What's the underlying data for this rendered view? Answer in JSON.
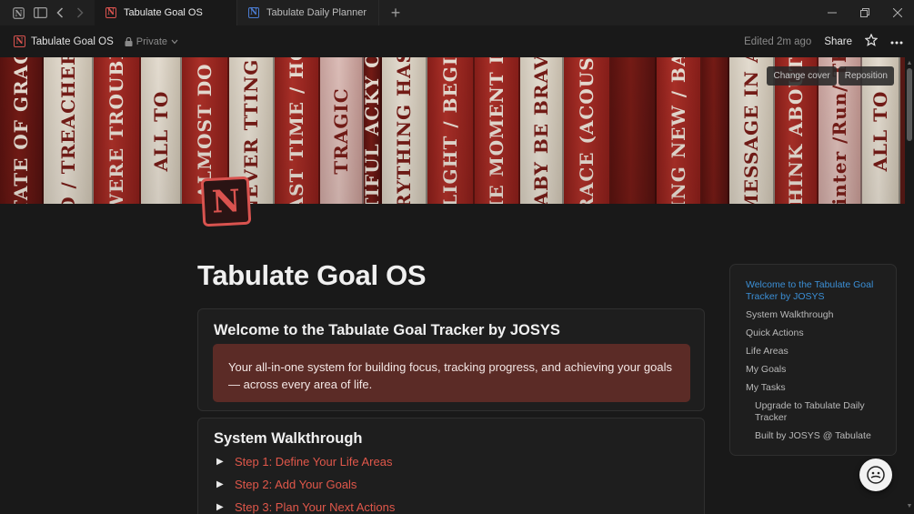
{
  "tabs": [
    {
      "label": "Tabulate Goal OS",
      "active": true,
      "icon": "notion-red-icon"
    },
    {
      "label": "Tabulate Daily Planner",
      "active": false,
      "icon": "notion-blue-icon"
    }
  ],
  "window_controls": {
    "new_tab": "+",
    "minimize": "–",
    "restore": "❐",
    "close": "✕"
  },
  "header": {
    "title": "Tabulate Goal OS",
    "privacy": "Private",
    "edited": "Edited 2m ago",
    "share": "Share"
  },
  "cover": {
    "change_cover": "Change cover",
    "reposition": "Reposition",
    "spines": [
      "STATE OF GRACE",
      "D / TREACHER",
      "I WERE TROUBLE",
      "ALL TO",
      "ALMOST DO",
      "WE ARE NEVER TTING BACK TO",
      "Y THE LAST TIME / HOLY GRO",
      "TRAGIC",
      "AUTIFUL ACKY ONE",
      "EVERYTHING HAS CH",
      "RLIGHT / BEGIN",
      "THE MOMENT I K",
      "BABY BE BRAVE",
      "GRACE (ACOUSTI",
      "",
      "THING NEW / BABE",
      "",
      "MESSAGE IN A",
      "I THINK ABOUT IT",
      "Winter /Run/ The",
      "ALL TO"
    ]
  },
  "page": {
    "title": "Tabulate Goal OS",
    "welcome_heading": "Welcome to the Tabulate Goal Tracker by JOSYS",
    "callout_text": "Your all-in-one system for building focus, tracking progress, and achieving your goals — across every area of life.",
    "walkthrough_heading": "System Walkthrough",
    "steps": [
      "Step 1: Define Your Life Areas",
      "Step 2: Add Your Goals",
      "Step 3: Plan Your Next Actions"
    ]
  },
  "toc": {
    "items": [
      {
        "label": "Welcome to the Tabulate Goal Tracker by JOSYS",
        "active": true,
        "sub": false
      },
      {
        "label": "System Walkthrough",
        "active": false,
        "sub": false
      },
      {
        "label": "Quick Actions",
        "active": false,
        "sub": false
      },
      {
        "label": "Life Areas",
        "active": false,
        "sub": false
      },
      {
        "label": "My Goals",
        "active": false,
        "sub": false
      },
      {
        "label": "My Tasks",
        "active": false,
        "sub": false
      },
      {
        "label": "Upgrade to Tabulate Daily Tracker",
        "active": false,
        "sub": true
      },
      {
        "label": "Built by JOSYS @ Tabulate",
        "active": false,
        "sub": true
      }
    ]
  },
  "colors": {
    "accent_link": "#3b8fd6",
    "step_link": "#e0574a",
    "callout_bg": "#5b2b26",
    "notion_red": "#d9534f"
  }
}
